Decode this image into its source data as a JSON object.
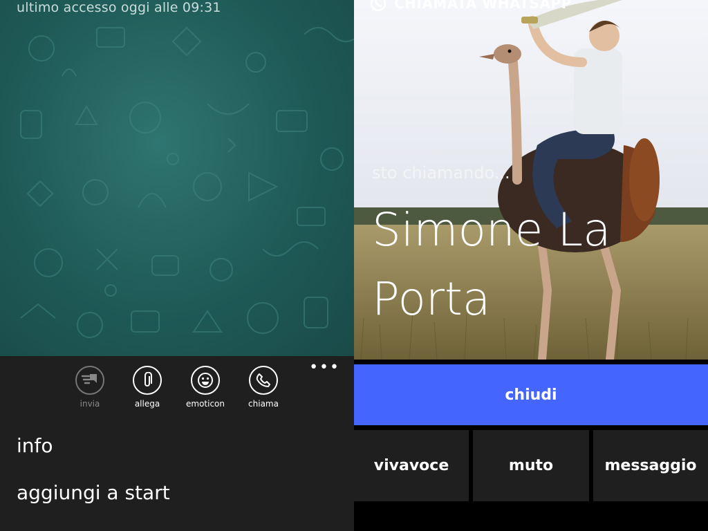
{
  "chat": {
    "last_seen": "ultimo accesso oggi alle 09:31"
  },
  "appbar": {
    "more": "•••",
    "buttons": [
      {
        "label": "invia",
        "icon": "send-icon",
        "enabled": false
      },
      {
        "label": "allega",
        "icon": "paperclip-icon",
        "enabled": true
      },
      {
        "label": "emoticon",
        "icon": "smiley-icon",
        "enabled": true
      },
      {
        "label": "chiama",
        "icon": "phone-icon",
        "enabled": true
      }
    ],
    "menu": [
      {
        "label": "info"
      },
      {
        "label": "aggiungi a start"
      }
    ]
  },
  "call": {
    "header": "CHIAMATA WHATSAPP",
    "status": "sto chiamando...",
    "name_line1": "Simone La",
    "name_line2": "Porta",
    "end_label": "chiudi",
    "actions": [
      {
        "label": "vivavoce"
      },
      {
        "label": "muto"
      },
      {
        "label": "messaggio"
      }
    ]
  },
  "colors": {
    "chat_background": "#1f5a57",
    "appbar": "#1f1f1f",
    "end_call": "#4466ff",
    "tile": "#1f1f1f"
  }
}
